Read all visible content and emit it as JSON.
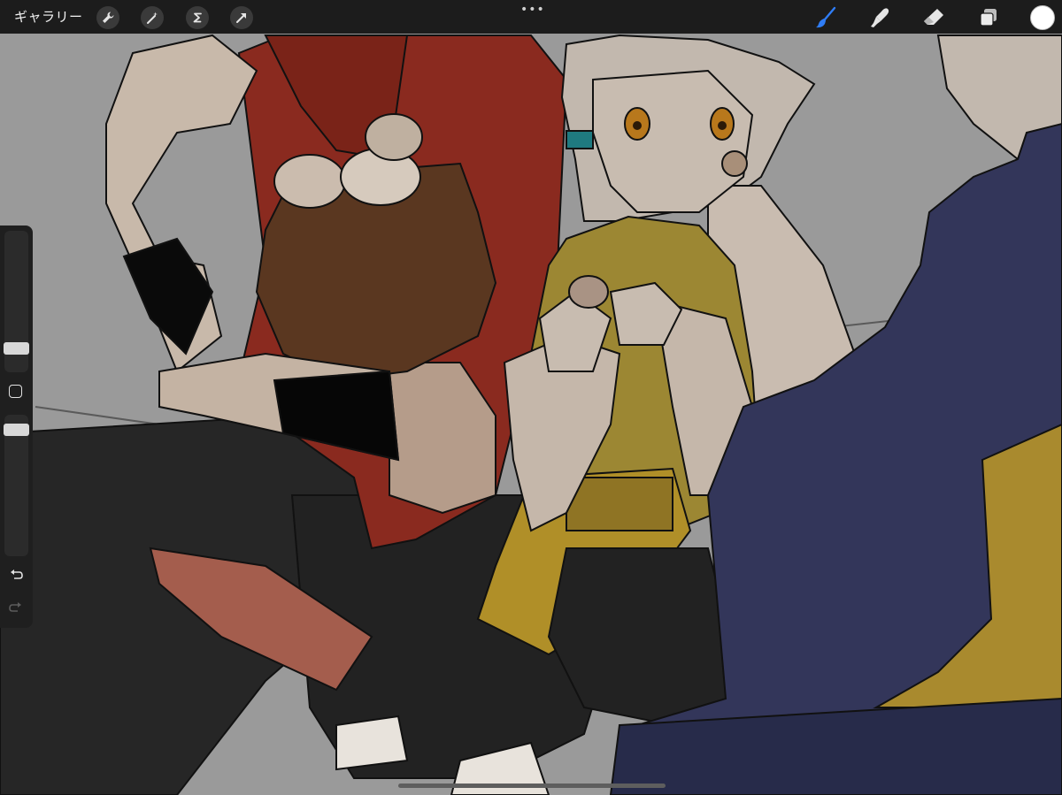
{
  "app": {
    "gallery_label": "ギャラリー"
  },
  "toolbar_left": {
    "icons": [
      "wrench-icon",
      "magic-wand-icon",
      "selection-s-icon",
      "transform-arrow-icon"
    ]
  },
  "toolbar_right": {
    "icons": [
      "brush-icon",
      "smudge-icon",
      "eraser-icon",
      "layers-icon"
    ],
    "active_tool": "brush-icon",
    "accent_color": "#2f7df6",
    "current_color": "#ffffff"
  },
  "sidebar": {
    "icons": [
      "undo-icon",
      "redo-icon"
    ]
  }
}
